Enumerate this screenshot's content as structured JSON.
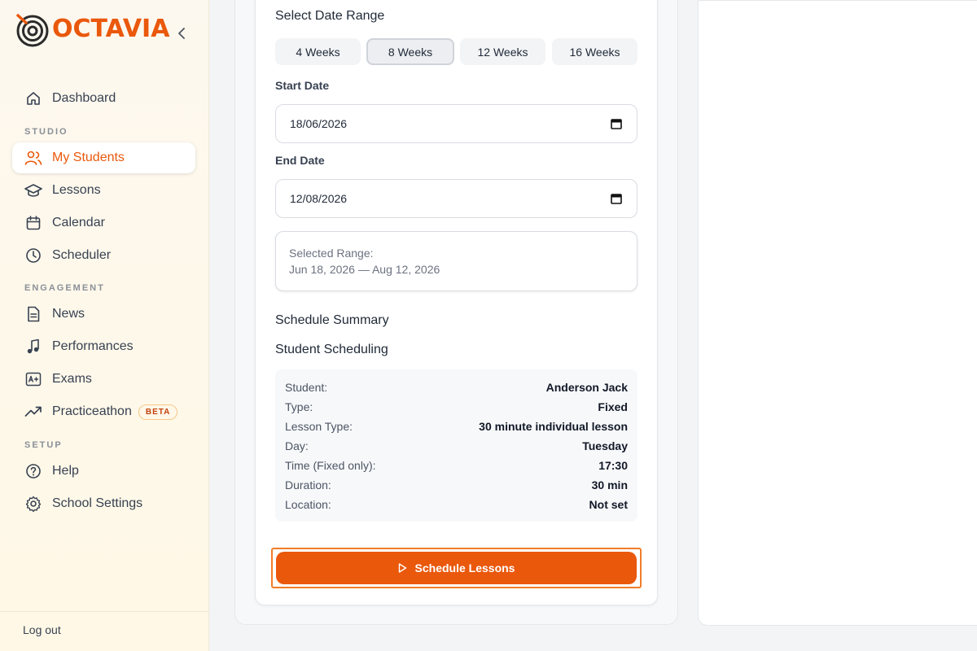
{
  "app": {
    "name": "OCTAVIA"
  },
  "sidebar": {
    "items": [
      {
        "label": "Dashboard"
      },
      {
        "label": "My Students"
      },
      {
        "label": "Lessons"
      },
      {
        "label": "Calendar"
      },
      {
        "label": "Scheduler"
      },
      {
        "label": "News"
      },
      {
        "label": "Performances"
      },
      {
        "label": "Exams"
      },
      {
        "label": "Practiceathon",
        "badge": "BETA"
      },
      {
        "label": "Help"
      },
      {
        "label": "School Settings"
      }
    ],
    "sections": [
      "STUDIO",
      "ENGAGEMENT",
      "SETUP"
    ],
    "active_item": "My Students",
    "logout_label": "Log out"
  },
  "form": {
    "date_range_title": "Select Date Range",
    "range_options": [
      "4 Weeks",
      "8 Weeks",
      "12 Weeks",
      "16 Weeks"
    ],
    "selected_range": "8 Weeks",
    "start_date_label": "Start Date",
    "start_date_value": "18/06/2026",
    "end_date_label": "End Date",
    "end_date_value": "12/08/2026",
    "selected_range_label": "Selected Range:",
    "selected_range_value": "Jun 18, 2026 — Aug 12, 2026"
  },
  "summary": {
    "title": "Schedule Summary",
    "subtitle": "Student Scheduling",
    "rows": [
      {
        "key": "Student:",
        "value": "Anderson Jack"
      },
      {
        "key": "Type:",
        "value": "Fixed"
      },
      {
        "key": "Lesson Type:",
        "value": "30 minute individual lesson"
      },
      {
        "key": "Day:",
        "value": "Tuesday"
      },
      {
        "key": "Time (Fixed only):",
        "value": "17:30"
      },
      {
        "key": "Duration:",
        "value": "30 min"
      },
      {
        "key": "Location:",
        "value": "Not set"
      }
    ]
  },
  "action": {
    "schedule_label": "Schedule Lessons"
  },
  "colors": {
    "accent": "#ea580c",
    "sidebar_bg": "#fdf8ef",
    "active_text": "#ea580c"
  }
}
